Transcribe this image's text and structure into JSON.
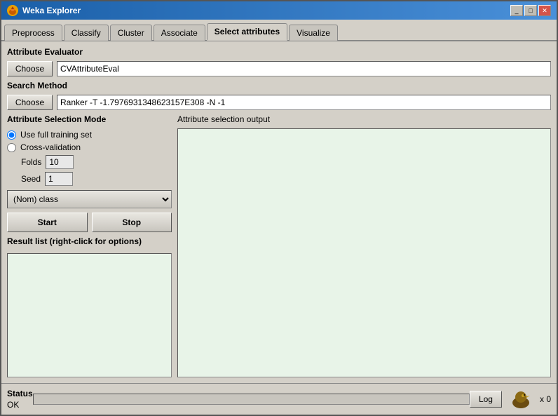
{
  "window": {
    "title": "Weka Explorer",
    "icon": "W"
  },
  "tabs": [
    {
      "id": "preprocess",
      "label": "Preprocess",
      "active": false
    },
    {
      "id": "classify",
      "label": "Classify",
      "active": false
    },
    {
      "id": "cluster",
      "label": "Cluster",
      "active": false
    },
    {
      "id": "associate",
      "label": "Associate",
      "active": false
    },
    {
      "id": "select-attributes",
      "label": "Select attributes",
      "active": true
    },
    {
      "id": "visualize",
      "label": "Visualize",
      "active": false
    }
  ],
  "attribute_evaluator": {
    "label": "Attribute Evaluator",
    "choose_label": "Choose",
    "value": "CVAttributeEval"
  },
  "search_method": {
    "label": "Search Method",
    "choose_label": "Choose",
    "value": "Ranker -T -1.7976931348623157E308 -N -1"
  },
  "attribute_selection_mode": {
    "label": "Attribute Selection Mode",
    "use_full_training": "Use full training set",
    "cross_validation": "Cross-validation",
    "folds_label": "Folds",
    "folds_value": "10",
    "seed_label": "Seed",
    "seed_value": "1"
  },
  "class_dropdown": {
    "options": [
      "(Nom) class"
    ],
    "selected": "(Nom) class"
  },
  "buttons": {
    "start": "Start",
    "stop": "Stop"
  },
  "result_list": {
    "label": "Result list (right-click for options)"
  },
  "output": {
    "label": "Attribute selection output"
  },
  "status": {
    "label": "Status",
    "value": "OK",
    "log_btn": "Log",
    "x_count": "x 0"
  },
  "window_controls": {
    "minimize": "_",
    "maximize": "□",
    "close": "✕"
  }
}
